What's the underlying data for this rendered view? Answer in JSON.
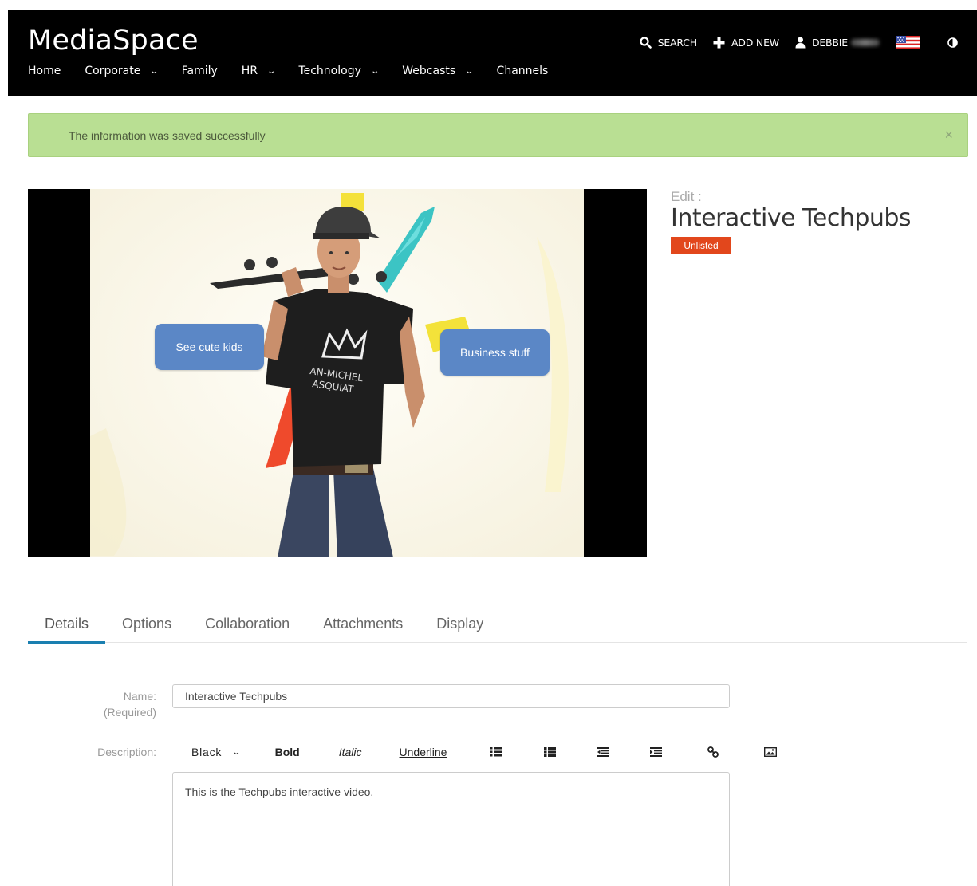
{
  "header": {
    "logo": "MediaSpace",
    "nav": [
      {
        "label": "Home",
        "dropdown": false
      },
      {
        "label": "Corporate",
        "dropdown": true
      },
      {
        "label": "Family",
        "dropdown": false
      },
      {
        "label": "HR",
        "dropdown": true
      },
      {
        "label": "Technology",
        "dropdown": true
      },
      {
        "label": "Webcasts",
        "dropdown": true
      },
      {
        "label": "Channels",
        "dropdown": false
      }
    ],
    "search_label": "SEARCH",
    "add_new_label": "ADD NEW",
    "user_label": "DEBBIE"
  },
  "alert": {
    "message": "The information was saved successfully",
    "close": "×"
  },
  "video": {
    "hotspots": [
      {
        "label": "See cute kids"
      },
      {
        "label": "Business stuff"
      }
    ]
  },
  "entry": {
    "edit_label": "Edit :",
    "title": "Interactive Techpubs",
    "status": "Unlisted"
  },
  "tabs": [
    "Details",
    "Options",
    "Collaboration",
    "Attachments",
    "Display"
  ],
  "form": {
    "name_label": "Name:",
    "name_required": "(Required)",
    "name_value": "Interactive Techpubs",
    "description_label": "Description:",
    "toolbar": {
      "color": "Black",
      "bold": "Bold",
      "italic": "Italic",
      "underline": "Underline"
    },
    "description_value": "This is the Techpubs interactive video."
  },
  "colors": {
    "header_bg": "#000000",
    "alert_bg": "#b9df93",
    "badge_bg": "#e2471c",
    "hotspot_bg": "#5b87c6",
    "tab_accent": "#1a7fb0"
  }
}
